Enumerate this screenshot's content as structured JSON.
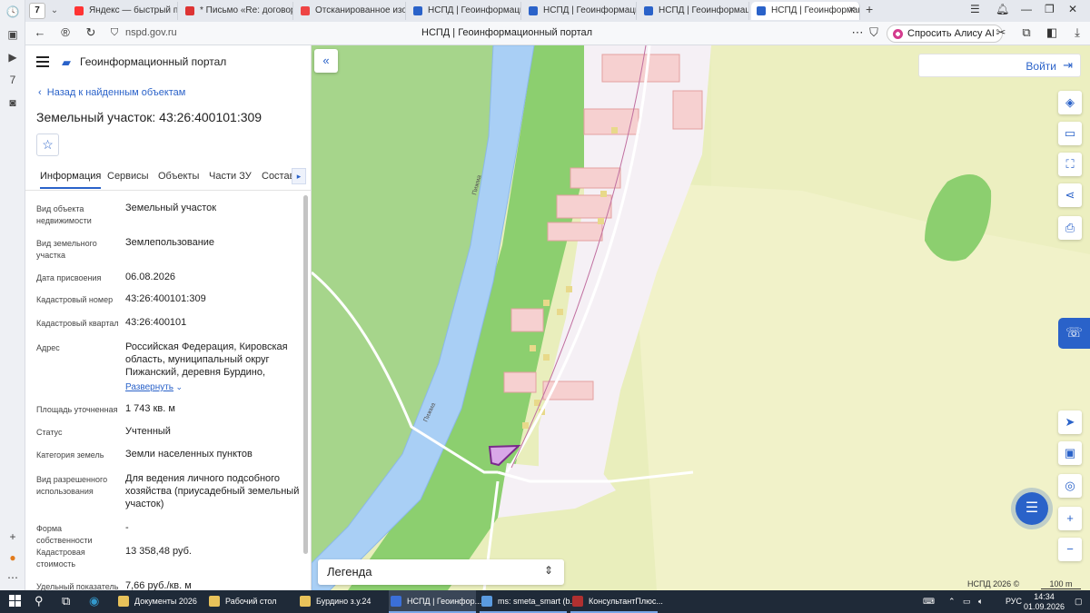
{
  "browser": {
    "tab_count": "7",
    "tabs": [
      {
        "title": "Яндекс — быстрый поиск",
        "color": "#f33"
      },
      {
        "title": "* Письмо «Re: договор.ро",
        "color": "#d33"
      },
      {
        "title": "Отсканированное изобр",
        "color": "#e44"
      },
      {
        "title": "НСПД | Геоинформацион",
        "color": "#2a62c9"
      },
      {
        "title": "НСПД | Геоинформацион",
        "color": "#2a62c9"
      },
      {
        "title": "НСПД | Геоинформацион",
        "color": "#2a62c9"
      },
      {
        "title": "НСПД | Геоинформацис",
        "color": "#2a62c9"
      }
    ],
    "url": "nspd.gov.ru",
    "page_title": "НСПД | Геоинформационный портал",
    "alisa_label": "Спросить Алису AI"
  },
  "panel": {
    "brand": "Геоинформационный портал",
    "back_link": "Назад к найденным объектам",
    "title": "Земельный участок: 43:26:400101:309",
    "tabs": [
      "Информация",
      "Сервисы",
      "Объекты",
      "Части ЗУ",
      "Состав"
    ],
    "fields": [
      {
        "label": "Вид объекта недвижимости",
        "value": "Земельный участок"
      },
      {
        "label": "Вид земельного участка",
        "value": "Землепользование"
      },
      {
        "label": "Дата присвоения",
        "value": "06.08.2026"
      },
      {
        "label": "Кадастровый номер",
        "value": "43:26:400101:309"
      },
      {
        "label": "Кадастровый квартал",
        "value": "43:26:400101"
      },
      {
        "label": "Адрес",
        "value": "Российская Федерация, Кировская область, муниципальный округ Пижанский, деревня Бурдино,"
      },
      {
        "label": "Площадь уточненная",
        "value": "1 743 кв. м"
      },
      {
        "label": "Статус",
        "value": "Учтенный"
      },
      {
        "label": "Категория земель",
        "value": "Земли населенных пунктов"
      },
      {
        "label": "Вид разрешенного использования",
        "value": "Для ведения личного подсобного хозяйства (приусадебный земельный участок)"
      },
      {
        "label": "Форма собственности",
        "value": "-"
      },
      {
        "label": "Кадастровая стоимость",
        "value": "13 358,48 руб."
      },
      {
        "label": "Удельный показатель",
        "value": "7,66 руб./кв. м"
      }
    ],
    "expand_link": "Развернуть"
  },
  "map": {
    "login": "Войти",
    "legend": "Легенда",
    "river_label_1": "Пижма",
    "river_label_2": "Пижма",
    "copyright": "НСПД 2026 ©",
    "scale": "100 m"
  },
  "taskbar": {
    "items": [
      {
        "label": "Документы 2026",
        "color": "#e8c25a"
      },
      {
        "label": "Рабочий стол",
        "color": "#e8c25a"
      },
      {
        "label": "Бурдино з.у.24",
        "color": "#e8c25a"
      },
      {
        "label": "НСПД | Геоинфор...",
        "color": "#3b6fd8"
      },
      {
        "label": "ms: smeta_smart (b...",
        "color": "#5a9be0"
      },
      {
        "label": "КонсультантПлюс...",
        "color": "#b03030"
      }
    ],
    "lang": "РУС",
    "time": "14:34",
    "date": "01.09.2026"
  }
}
